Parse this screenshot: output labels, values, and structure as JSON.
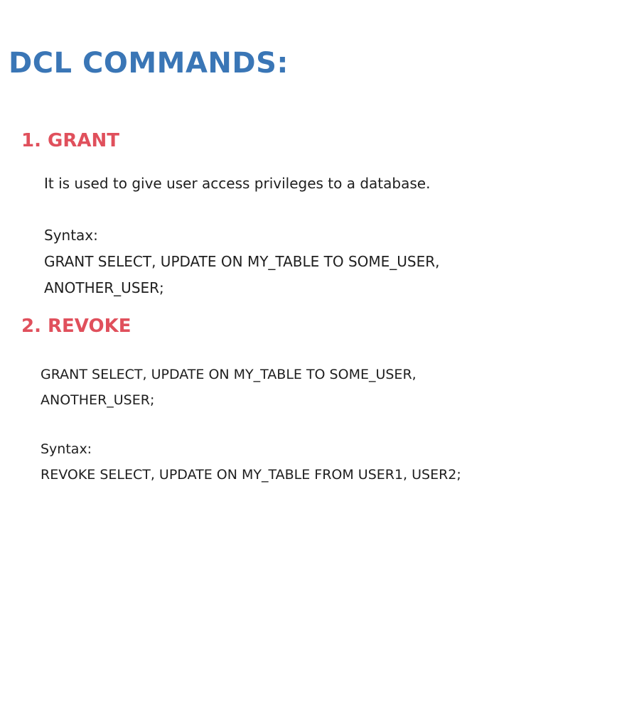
{
  "title": "DCL COMMANDS:",
  "sections": [
    {
      "heading": "1. GRANT",
      "description": "It is used to give user access privileges to a database.",
      "syntax_label": "Syntax:",
      "syntax_lines": [
        "GRANT SELECT, UPDATE ON MY_TABLE TO SOME_USER,",
        "ANOTHER_USER;"
      ]
    },
    {
      "heading": "2. REVOKE",
      "description_lines": [
        "GRANT SELECT, UPDATE ON MY_TABLE TO SOME_USER,",
        "ANOTHER_USER;"
      ],
      "syntax_label": "Syntax:",
      "syntax_lines": [
        "REVOKE SELECT, UPDATE ON MY_TABLE FROM USER1, USER2;"
      ]
    }
  ],
  "colors": {
    "title": "#3a76b6",
    "heading": "#e0505c",
    "text": "#1e1e1e"
  }
}
